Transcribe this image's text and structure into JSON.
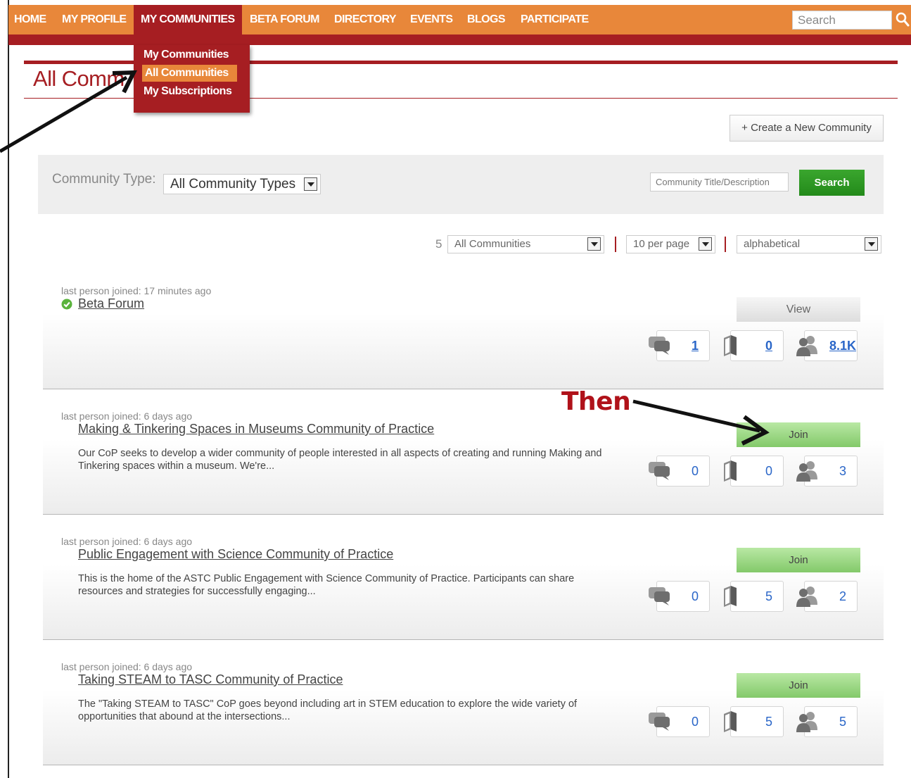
{
  "nav": {
    "items": [
      "HOME",
      "MY PROFILE",
      "MY COMMUNITIES",
      "BETA FORUM",
      "DIRECTORY",
      "EVENTS",
      "BLOGS",
      "PARTICIPATE"
    ],
    "active_index": 2,
    "search_placeholder": "Search"
  },
  "dropdown": {
    "items": [
      "My Communities",
      "All Communities",
      "My Subscriptions"
    ],
    "highlighted_index": 1
  },
  "page": {
    "title": "All Comm",
    "create_button": "+ Create a New Community"
  },
  "filter": {
    "community_type_label": "Community Type:",
    "community_type_value": "All Community Types",
    "title_input_placeholder": "Community Title/Description",
    "search_button": "Search"
  },
  "list_controls": {
    "count": "5",
    "scope": "All Communities",
    "per_page": "10 per page",
    "sort": "alphabetical"
  },
  "communities": [
    {
      "last_joined": "last person joined: 17 minutes ago",
      "title": "Beta Forum",
      "description": "",
      "action": "View",
      "discussions": "1",
      "resources": "0",
      "members": "8.1K"
    },
    {
      "last_joined": "last person joined: 6 days ago",
      "title": "Making & Tinkering Spaces in Museums Community of Practice",
      "description": "Our CoP seeks to develop a wider community of people interested in all aspects of creating and running Making and Tinkering spaces within a museum. We're...",
      "action": "Join",
      "discussions": "0",
      "resources": "0",
      "members": "3"
    },
    {
      "last_joined": "last person joined: 6 days ago",
      "title": "Public Engagement with Science Community of Practice",
      "description": "This is the home of the ASTC Public Engagement with Science Community of Practice. Participants can share resources and strategies for successfully engaging...",
      "action": "Join",
      "discussions": "0",
      "resources": "5",
      "members": "2"
    },
    {
      "last_joined": "last person joined: 6 days ago",
      "title": "Taking STEAM to TASC Community of Practice",
      "description": "The \"Taking STEAM to TASC\" CoP goes beyond including art in STEM education to explore the wide variety of opportunities that abound at the intersections...",
      "action": "Join",
      "discussions": "0",
      "resources": "5",
      "members": "5"
    }
  ],
  "annotation": {
    "then_label": "Then"
  },
  "colors": {
    "nav_orange": "#e8873a",
    "brand_red": "#a61e22",
    "search_green": "#238a1a",
    "join_green": "#83c96a",
    "link_blue": "#2a66c8"
  }
}
